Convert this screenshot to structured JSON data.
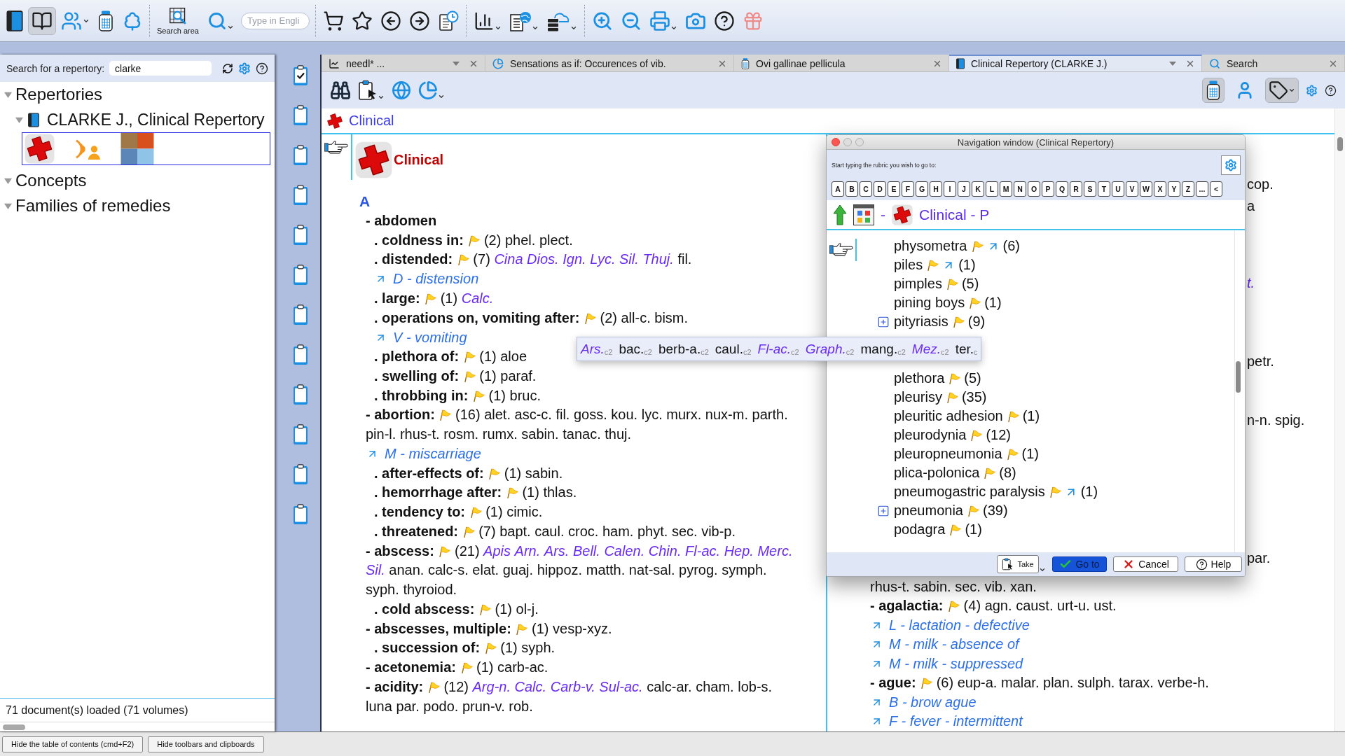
{
  "toolbar": {
    "view_buttons": [
      {
        "selected": false
      },
      {
        "selected": true
      },
      {
        "selected": false
      },
      {
        "selected": false
      },
      {
        "selected": false
      }
    ],
    "search_area_label": "Search area",
    "search_field": {
      "placeholder": "Type in Engli"
    }
  },
  "left_panel": {
    "search_label": "Search for a repertory:",
    "search_value": "clarke",
    "tree": [
      {
        "label": "Repertories",
        "expanded": true,
        "children": [
          {
            "label": "CLARKE J., Clinical Repertory",
            "expanded": true
          }
        ]
      },
      {
        "label": "Concepts",
        "expanded": true
      },
      {
        "label": "Families of remedies",
        "expanded": true
      }
    ],
    "status": "71 document(s) loaded (71 volumes)"
  },
  "clipboards": [
    {
      "checked": true
    },
    {
      "checked": false
    },
    {
      "checked": false
    },
    {
      "checked": false
    },
    {
      "checked": false
    },
    {
      "checked": false
    },
    {
      "checked": false
    },
    {
      "checked": false
    },
    {
      "checked": false
    },
    {
      "checked": false
    },
    {
      "checked": false
    },
    {
      "checked": false
    }
  ],
  "tabs": [
    {
      "label": "needl* ...",
      "selected": false,
      "has_menu": true
    },
    {
      "label": "Sensations as if: Occurences of vib.",
      "selected": false,
      "has_menu": false
    },
    {
      "label": "Ovi gallinae pellicula",
      "selected": false,
      "has_menu": false
    },
    {
      "label": "Clinical Repertory (CLARKE J.)",
      "selected": true,
      "has_menu": true
    },
    {
      "label": "Search",
      "selected": false,
      "has_menu": false
    }
  ],
  "doc_toolbar": {
    "right_buttons": [
      {
        "selected": true
      },
      {
        "selected": false
      },
      {
        "selected": true
      }
    ]
  },
  "document": {
    "breadcrumb": "Clinical",
    "chapter_title": "Clinical",
    "letter": "A",
    "entries": [
      {
        "label": "- abdomen",
        "children": [
          {
            "label": ". coldness in:",
            "count": "(2)",
            "remedies": [
              {
                "name": "phel.",
                "highlighted": false
              },
              {
                "name": "plect.",
                "highlighted": false
              }
            ]
          },
          {
            "label": ". distended:",
            "count": "(7)",
            "remedies": [
              {
                "name": "Cina",
                "highlighted": true
              },
              {
                "name": "Dios.",
                "highlighted": true
              },
              {
                "name": "Ign.",
                "highlighted": true
              },
              {
                "name": "Lyc.",
                "highlighted": true
              },
              {
                "name": "Sil.",
                "highlighted": true
              },
              {
                "name": "Thuj.",
                "highlighted": true
              },
              {
                "name": "fil.",
                "highlighted": false
              }
            ],
            "xrefs": [
              "D - distension"
            ]
          },
          {
            "label": ". large:",
            "count": "(1)",
            "remedies": [
              {
                "name": "Calc.",
                "highlighted": true
              }
            ]
          },
          {
            "label": ". operations on, vomiting after:",
            "count": "(2)",
            "remedies": [
              {
                "name": "all-c.",
                "highlighted": false
              },
              {
                "name": "bism.",
                "highlighted": false
              }
            ],
            "xrefs": [
              "V - vomiting"
            ]
          },
          {
            "label": ". plethora of:",
            "count": "(1)",
            "remedies": [
              {
                "name": "aloe",
                "highlighted": false
              }
            ]
          },
          {
            "label": ". swelling of:",
            "count": "(1)",
            "remedies": [
              {
                "name": "paraf.",
                "highlighted": false
              }
            ]
          },
          {
            "label": ". throbbing in:",
            "count": "(1)",
            "remedies": [
              {
                "name": "bruc.",
                "highlighted": false
              }
            ]
          }
        ]
      },
      {
        "label": "- abortion:",
        "count": "(16)",
        "remedies": [
          {
            "name": "alet.",
            "highlighted": false
          },
          {
            "name": "asc-c.",
            "highlighted": false
          },
          {
            "name": "fil.",
            "highlighted": false
          },
          {
            "name": "goss.",
            "highlighted": false
          },
          {
            "name": "kou.",
            "highlighted": false
          },
          {
            "name": "lyc.",
            "highlighted": false
          },
          {
            "name": "murx.",
            "highlighted": false
          },
          {
            "name": "nux-m.",
            "highlighted": false
          },
          {
            "name": "parth.",
            "highlighted": false
          },
          {
            "name": "pin-l.",
            "highlighted": false
          },
          {
            "name": "rhus-t.",
            "highlighted": false
          },
          {
            "name": "rosm.",
            "highlighted": false
          },
          {
            "name": "rumx.",
            "highlighted": false
          },
          {
            "name": "sabin.",
            "highlighted": false
          },
          {
            "name": "tanac.",
            "highlighted": false
          },
          {
            "name": "thuj.",
            "highlighted": false
          }
        ],
        "xrefs": [
          "M - miscarriage"
        ],
        "children": [
          {
            "label": ". after-effects of:",
            "count": "(1)",
            "remedies": [
              {
                "name": "sabin.",
                "highlighted": false
              }
            ]
          },
          {
            "label": ". hemorrhage after:",
            "count": "(1)",
            "remedies": [
              {
                "name": "thlas.",
                "highlighted": false
              }
            ]
          },
          {
            "label": ". tendency to:",
            "count": "(1)",
            "remedies": [
              {
                "name": "cimic.",
                "highlighted": false
              }
            ]
          },
          {
            "label": ". threatened:",
            "count": "(7)",
            "remedies": [
              {
                "name": "bapt.",
                "highlighted": false
              },
              {
                "name": "caul.",
                "highlighted": false
              },
              {
                "name": "croc.",
                "highlighted": false
              },
              {
                "name": "ham.",
                "highlighted": false
              },
              {
                "name": "phyt.",
                "highlighted": false
              },
              {
                "name": "sec.",
                "highlighted": false
              },
              {
                "name": "vib-p.",
                "highlighted": false
              }
            ]
          }
        ]
      },
      {
        "label": "- abscess:",
        "count": "(21)",
        "remedies": [
          {
            "name": "Apis",
            "highlighted": true
          },
          {
            "name": "Arn.",
            "highlighted": true
          },
          {
            "name": "Ars.",
            "highlighted": true
          },
          {
            "name": "Bell.",
            "highlighted": true
          },
          {
            "name": "Calen.",
            "highlighted": true
          },
          {
            "name": "Chin.",
            "highlighted": true
          },
          {
            "name": "Fl-ac.",
            "highlighted": true
          },
          {
            "name": "Hep.",
            "highlighted": true
          },
          {
            "name": "Merc.",
            "highlighted": true
          },
          {
            "name": "Sil.",
            "highlighted": true
          },
          {
            "name": "anan.",
            "highlighted": false
          },
          {
            "name": "calc-s.",
            "highlighted": false
          },
          {
            "name": "elat.",
            "highlighted": false
          },
          {
            "name": "guaj.",
            "highlighted": false
          },
          {
            "name": "hippoz.",
            "highlighted": false
          },
          {
            "name": "matth.",
            "highlighted": false
          },
          {
            "name": "nat-sal.",
            "highlighted": false
          },
          {
            "name": "pyrog.",
            "highlighted": false
          },
          {
            "name": "symph.",
            "highlighted": false
          },
          {
            "name": "syph.",
            "highlighted": false
          },
          {
            "name": "thyroiod.",
            "highlighted": false
          }
        ],
        "children": [
          {
            "label": ". cold abscess:",
            "count": "(1)",
            "remedies": [
              {
                "name": "ol-j.",
                "highlighted": false
              }
            ]
          }
        ]
      },
      {
        "label": "- abscesses, multiple:",
        "count": "(1)",
        "remedies": [
          {
            "name": "vesp-xyz.",
            "highlighted": false
          }
        ],
        "children": [
          {
            "label": ". succession of:",
            "count": "(1)",
            "remedies": [
              {
                "name": "syph.",
                "highlighted": false
              }
            ]
          }
        ]
      },
      {
        "label": "- acetonemia:",
        "count": "(1)",
        "remedies": [
          {
            "name": "carb-ac.",
            "highlighted": false
          }
        ]
      },
      {
        "label": "- acidity:",
        "count": "(12)",
        "remedies": [
          {
            "name": "Arg-n.",
            "highlighted": true
          },
          {
            "name": "Calc.",
            "highlighted": true
          },
          {
            "name": "Carb-v.",
            "highlighted": true
          },
          {
            "name": "Sul-ac.",
            "highlighted": true
          },
          {
            "name": "calc-ar.",
            "highlighted": false
          },
          {
            "name": "cham.",
            "highlighted": false
          },
          {
            "name": "lob-s.",
            "highlighted": false
          },
          {
            "name": "luna",
            "highlighted": false
          },
          {
            "name": "par.",
            "highlighted": false
          },
          {
            "name": "podo.",
            "highlighted": false
          },
          {
            "name": "prun-v.",
            "highlighted": false
          },
          {
            "name": "rob.",
            "highlighted": false
          }
        ]
      }
    ],
    "right_column": {
      "fragments": [
        {
          "kind": "tail",
          "text": "cop.",
          "highlighted": false
        },
        {
          "kind": "tail",
          "text": "a",
          "highlighted": false
        },
        {
          "kind": "tail",
          "text": "t.",
          "highlighted": true
        },
        {
          "kind": "tail",
          "text": "petr.",
          "highlighted": false
        },
        {
          "kind": "tail",
          "text": "n-n. spig.",
          "highlighted": false
        },
        {
          "kind": "tail",
          "text": "par.",
          "highlighted": false
        },
        {
          "kind": "line",
          "text": "rhus-t. sabin. sec. vib. xan.",
          "highlighted": false
        }
      ],
      "entries": [
        {
          "label": "- agalactia:",
          "count": "(4)",
          "remedies": [
            {
              "name": "agn.",
              "highlighted": false
            },
            {
              "name": "caust.",
              "highlighted": false
            },
            {
              "name": "urt-u.",
              "highlighted": false
            },
            {
              "name": "ust.",
              "highlighted": false
            }
          ],
          "xrefs": [
            "L - lactation - defective",
            "M - milk - absence of",
            "M - milk - suppressed"
          ]
        },
        {
          "label": "- ague:",
          "count": "(6)",
          "remedies": [
            {
              "name": "eup-a.",
              "highlighted": false
            },
            {
              "name": "malar.",
              "highlighted": false
            },
            {
              "name": "plan.",
              "highlighted": false
            },
            {
              "name": "sulph.",
              "highlighted": false
            },
            {
              "name": "tarax.",
              "highlighted": false
            },
            {
              "name": "verbe-h.",
              "highlighted": false
            }
          ],
          "xrefs": [
            "B - brow ague",
            "F - fever - intermittent"
          ]
        }
      ]
    }
  },
  "navigation_window": {
    "title": "Navigation window (Clinical Repertory)",
    "prompt": "Start typing the rubric you wish to go to:",
    "letters": [
      "A",
      "B",
      "C",
      "D",
      "E",
      "F",
      "G",
      "H",
      "I",
      "J",
      "K",
      "L",
      "M",
      "N",
      "O",
      "P",
      "Q",
      "R",
      "S",
      "T",
      "U",
      "V",
      "W",
      "X",
      "Y",
      "Z",
      "...",
      "<"
    ],
    "path_separator": "-",
    "path": "Clinical - P",
    "items": [
      {
        "label": "physometra",
        "count": "(6)",
        "has_xref": true,
        "expandable": false
      },
      {
        "label": "piles",
        "count": "(1)",
        "has_xref": true,
        "expandable": false
      },
      {
        "label": "pimples",
        "count": "(5)",
        "has_xref": false,
        "expandable": false
      },
      {
        "label": "pining boys",
        "count": "(1)",
        "has_xref": false,
        "expandable": false
      },
      {
        "label": "pityriasis",
        "count": "(9)",
        "has_xref": false,
        "expandable": true
      },
      {
        "label": "plethora",
        "count": "(5)",
        "has_xref": false,
        "expandable": false
      },
      {
        "label": "pleurisy",
        "count": "(35)",
        "has_xref": false,
        "expandable": false
      },
      {
        "label": "pleuritic adhesion",
        "count": "(1)",
        "has_xref": false,
        "expandable": false
      },
      {
        "label": "pleurodynia",
        "count": "(12)",
        "has_xref": false,
        "expandable": false
      },
      {
        "label": "pleuropneumonia",
        "count": "(1)",
        "has_xref": false,
        "expandable": false
      },
      {
        "label": "plica-polonica",
        "count": "(8)",
        "has_xref": false,
        "expandable": false
      },
      {
        "label": "pneumogastric paralysis",
        "count": "(1)",
        "has_xref": true,
        "expandable": false
      },
      {
        "label": "pneumonia",
        "count": "(39)",
        "has_xref": false,
        "expandable": true
      },
      {
        "label": "podagra",
        "count": "(1)",
        "has_xref": false,
        "expandable": false
      }
    ],
    "buttons": [
      {
        "label": "Take",
        "kind": "menu"
      },
      {
        "label": "Go to",
        "kind": "primary"
      },
      {
        "label": "Cancel",
        "kind": "cancel"
      },
      {
        "label": "Help",
        "kind": "help"
      }
    ]
  },
  "tooltip": {
    "remedies": [
      {
        "text": "Ars.$_{c2}$",
        "highlighted": true
      },
      {
        "text": "bac.$_{c2}$",
        "highlighted": false
      },
      {
        "text": "berb-a.$_{c2}$",
        "highlighted": false
      },
      {
        "text": "caul.$_{c2}$",
        "highlighted": false
      },
      {
        "text": "Fl-ac.$_{c2}$",
        "highlighted": true
      },
      {
        "text": "Graph.$_{c2}$",
        "highlighted": true
      },
      {
        "text": "mang.$_{c2}$",
        "highlighted": false
      },
      {
        "text": "Mez.$_{c2}$",
        "highlighted": true
      },
      {
        "text": "ter.$_{c}$",
        "highlighted": false
      }
    ]
  },
  "footer_buttons": [
    "Hide the table of contents (cmd+F2)",
    "Hide toolbars and clipboards"
  ]
}
